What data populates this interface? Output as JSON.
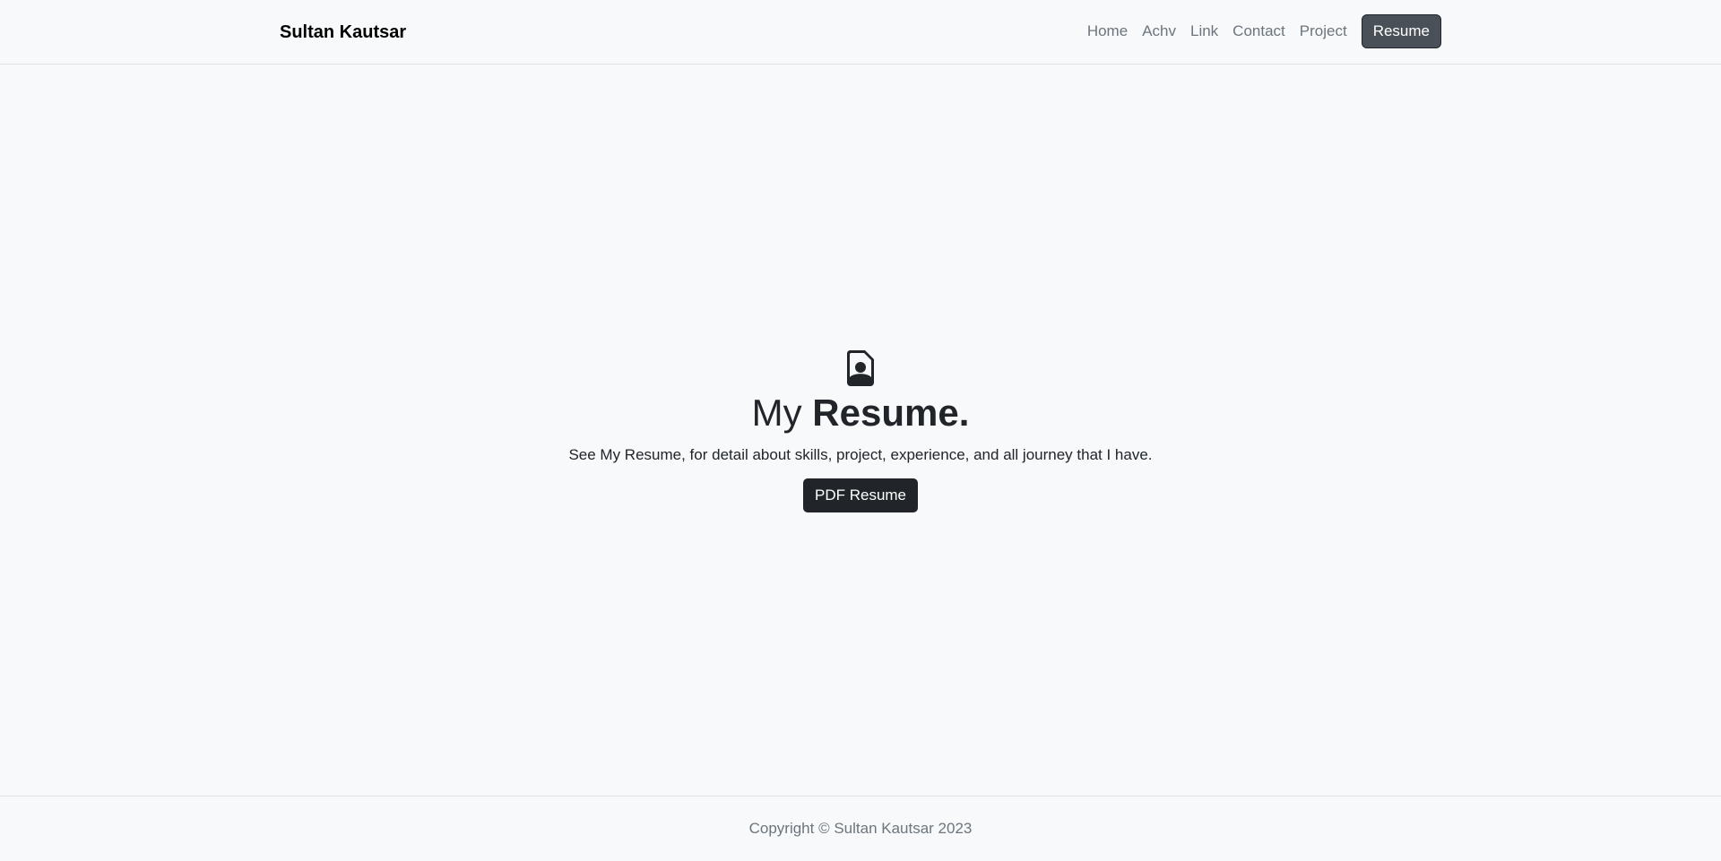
{
  "navbar": {
    "brand": "Sultan Kautsar",
    "links": [
      "Home",
      "Achv",
      "Link",
      "Contact",
      "Project"
    ],
    "active_button": "Resume"
  },
  "hero": {
    "icon": "file-person-icon",
    "title_light": "My",
    "title_bold": "Resume.",
    "subtitle": "See My Resume, for detail about skills, project, experience, and all journey that I have.",
    "button_label": "PDF Resume"
  },
  "footer": {
    "copyright": "Copyright © Sultan Kautsar 2023"
  },
  "colors": {
    "background": "#f8f9fa",
    "dark": "#212529",
    "nav_button": "#495057",
    "muted_text": "#6c757d"
  }
}
